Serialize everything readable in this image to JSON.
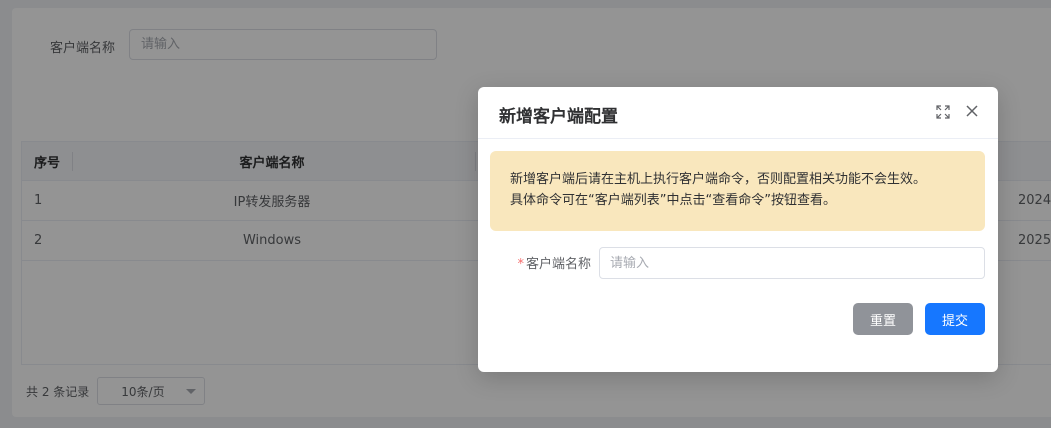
{
  "search": {
    "label": "客户端名称",
    "placeholder": "请输入"
  },
  "table": {
    "columns": [
      "序号",
      "客户端名称"
    ],
    "rows": [
      {
        "index": "1",
        "name": "IP转发服务器",
        "date": "2024-"
      },
      {
        "index": "2",
        "name": "Windows",
        "date": "2025-"
      }
    ]
  },
  "pagination": {
    "total_text": "共 2 条记录",
    "page_size": "10条/页"
  },
  "dialog": {
    "title": "新增客户端配置",
    "alert_line1": "新增客户端后请在主机上执行客户端命令，否则配置相关功能不会生效。",
    "alert_line2": "具体命令可在“客户端列表”中点击“查看命令”按钮查看。",
    "field_label": "客户端名称",
    "field_required_mark": "*",
    "field_placeholder": "请输入",
    "reset_label": "重置",
    "submit_label": "提交"
  },
  "colors": {
    "primary": "#1677ff",
    "reset": "#909399",
    "alert_bg": "#f9e7bd",
    "required": "#f56c6c"
  },
  "icons": {
    "fullscreen": "fullscreen-icon",
    "close": "close-icon",
    "dropdown": "chevron-down-icon"
  }
}
